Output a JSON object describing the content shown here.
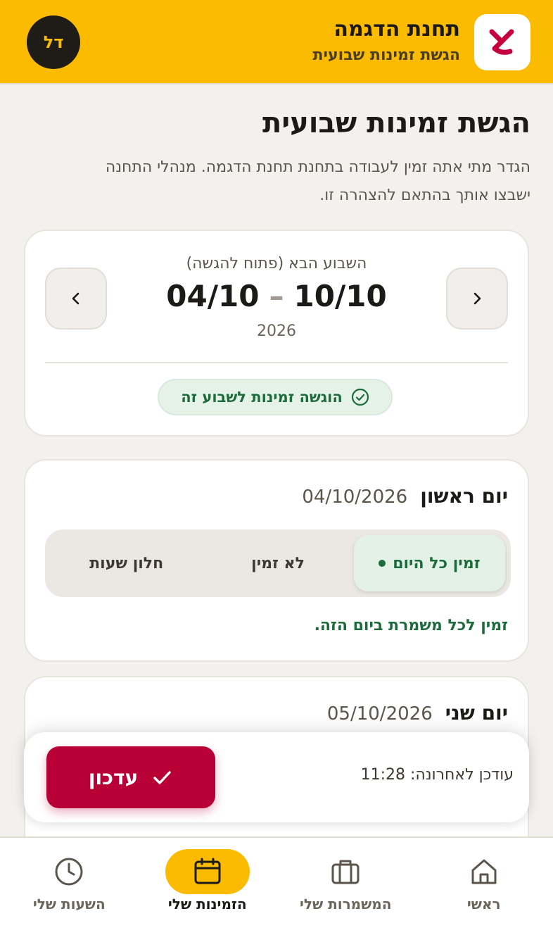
{
  "header": {
    "station_name": "תחנת הדגמה",
    "subtitle": "הגשת זמינות שבועית",
    "avatar_initials": "דל"
  },
  "page": {
    "title": "הגשת זמינות שבועית",
    "description": "הגדר מתי אתה זמין לעבודה בתחנת תחנת הדגמה. מנהלי התחנה ישבצו אותך בהתאם להצהרה זו."
  },
  "week": {
    "label": "השבוע הבא (פתוח להגשה)",
    "range_end": "10/10",
    "range_start": "04/10",
    "dash": "–",
    "year": "2026",
    "status": "הוגשה זמינות לשבוע זה"
  },
  "days": [
    {
      "name": "יום ראשון",
      "date": "04/10/2026",
      "options": [
        "זמין כל היום",
        "לא זמין",
        "חלון שעות"
      ],
      "selected": "זמין כל היום",
      "note": "זמין לכל משמרת ביום הזה."
    },
    {
      "name": "יום שני",
      "date": "05/10/2026"
    }
  ],
  "save_bar": {
    "last_updated_label": "עודכן לאחרונה:",
    "last_updated_time": "11:28",
    "update_button": "עדכון"
  },
  "bottom_nav": {
    "items": [
      {
        "label": "ראשי",
        "icon": "home-icon"
      },
      {
        "label": "המשמרות שלי",
        "icon": "briefcase-icon"
      },
      {
        "label": "הזמינות שלי",
        "icon": "calendar-icon",
        "active": true
      },
      {
        "label": "השעות שלי",
        "icon": "clock-icon"
      }
    ]
  },
  "colors": {
    "brand_yellow": "#fbbb00",
    "brand_red": "#b80037",
    "success_green": "#1d6b3b"
  }
}
